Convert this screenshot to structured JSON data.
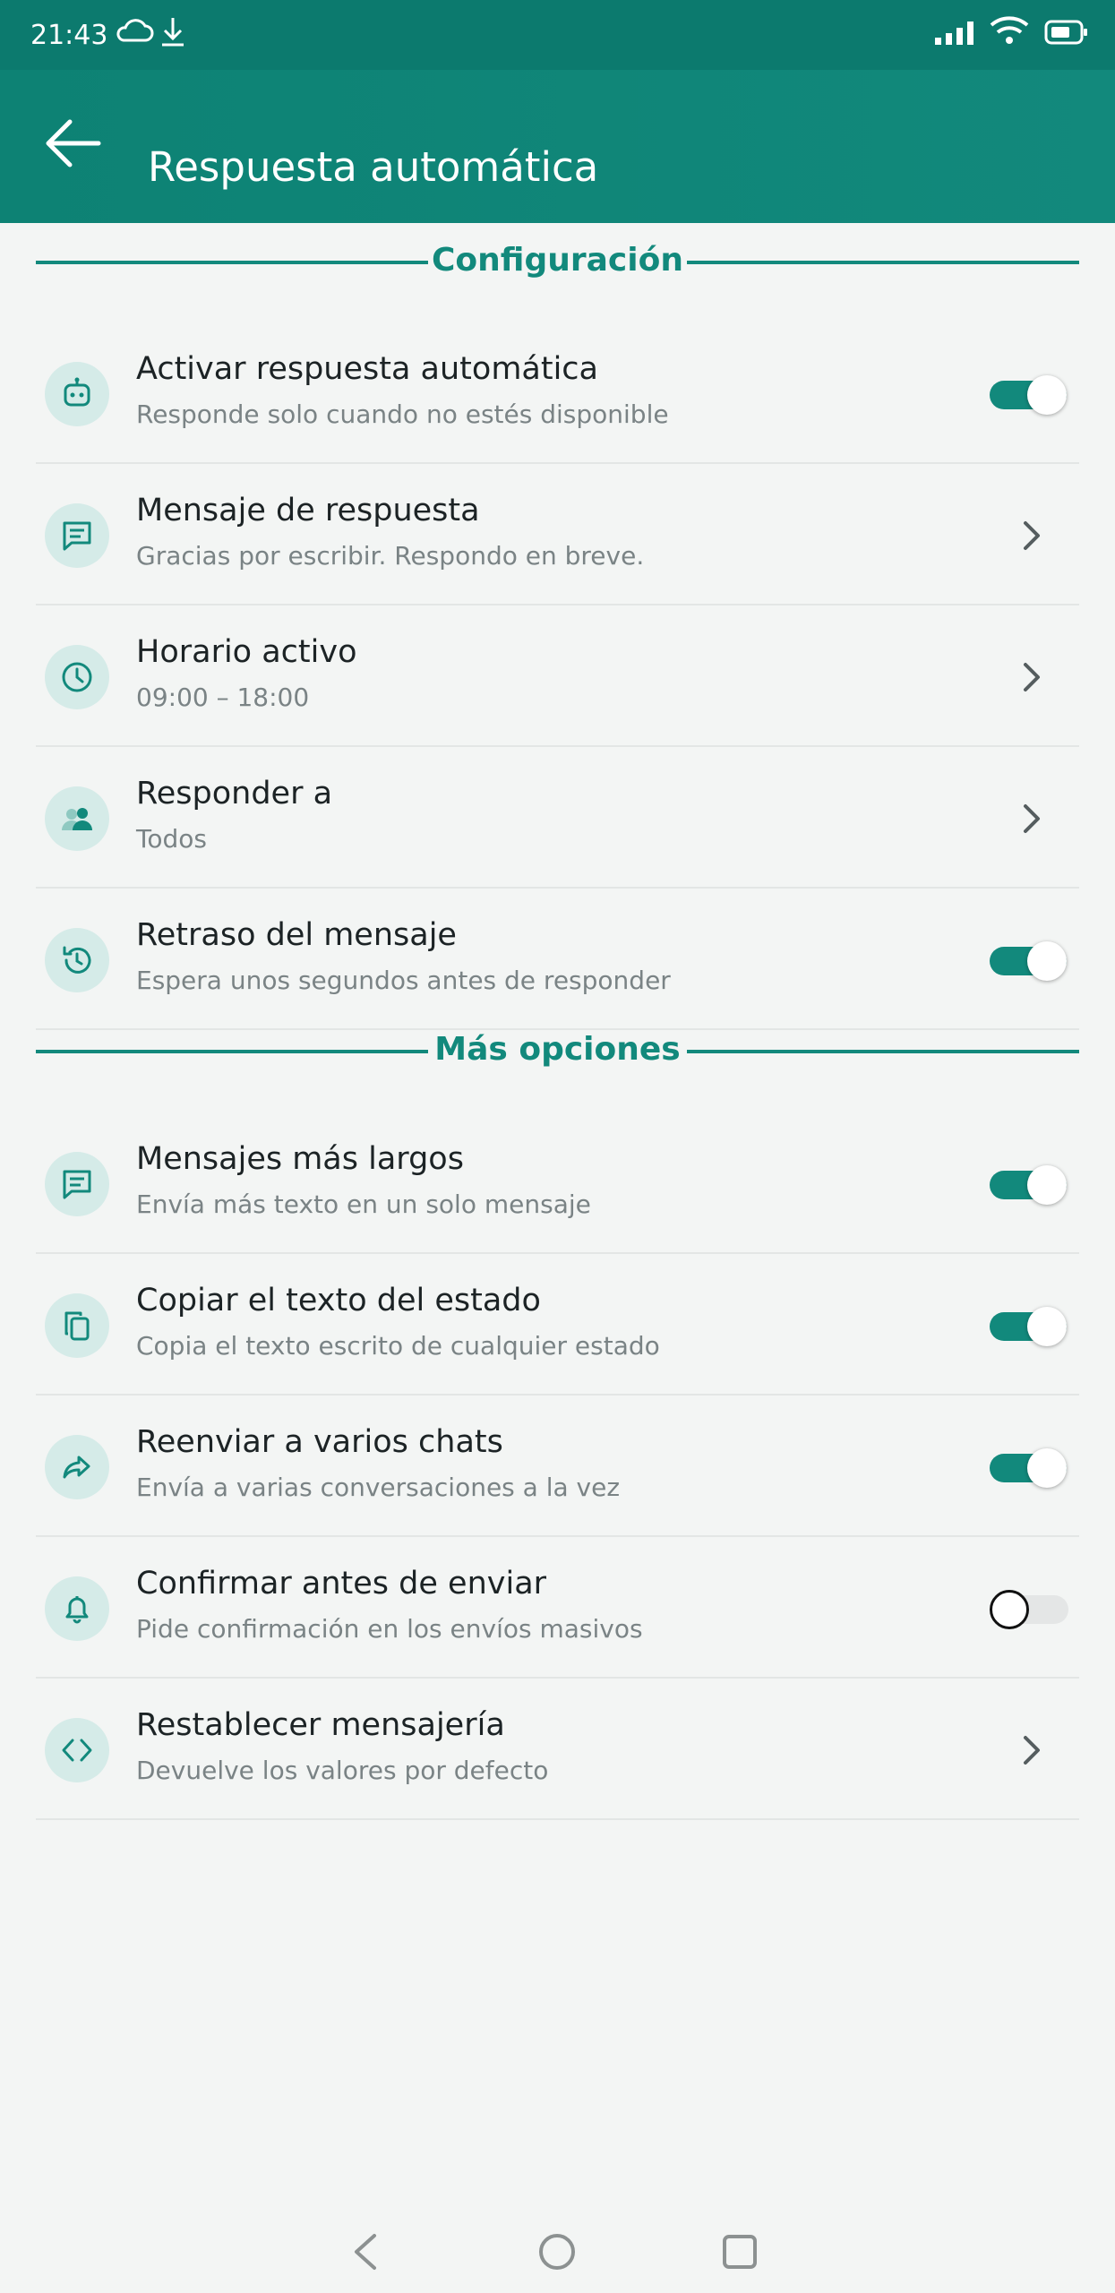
{
  "status_bar": {
    "time": "21:43",
    "icons": [
      "cloud-icon",
      "download-icon",
      "signal-icon",
      "wifi-icon",
      "battery-icon"
    ]
  },
  "app_bar": {
    "title": "Respuesta automática",
    "back_icon": "arrow-left-icon"
  },
  "colors": {
    "primary": "#12897c",
    "status_bar": "#0c7a6e",
    "icon_bg": "#d5ebe8",
    "background": "#f3f5f4"
  },
  "sections": [
    {
      "header": "Configuración",
      "items": [
        {
          "icon": "robot-icon",
          "title": "Activar respuesta automática",
          "subtitle": "Responde solo cuando no estés disponible",
          "control": "toggle",
          "on": true
        },
        {
          "icon": "message-icon",
          "title": "Mensaje de respuesta",
          "subtitle": "Gracias por escribir. Respondo en breve.",
          "control": "chevron"
        },
        {
          "icon": "clock-icon",
          "title": "Horario activo",
          "subtitle": "09:00 – 18:00",
          "control": "chevron"
        },
        {
          "icon": "people-icon",
          "title": "Responder a",
          "subtitle": "Todos",
          "control": "chevron"
        },
        {
          "icon": "history-icon",
          "title": "Retraso del mensaje",
          "subtitle": "Espera unos segundos antes de responder",
          "control": "toggle",
          "on": true
        }
      ]
    },
    {
      "header": "Más opciones",
      "items": [
        {
          "icon": "message-icon",
          "title": "Mensajes más largos",
          "subtitle": "Envía más texto en un solo mensaje",
          "control": "toggle",
          "on": true
        },
        {
          "icon": "copy-icon",
          "title": "Copiar el texto del estado",
          "subtitle": "Copia el texto escrito de cualquier estado",
          "control": "toggle",
          "on": true
        },
        {
          "icon": "forward-icon",
          "title": "Reenviar a varios chats",
          "subtitle": "Envía a varias conversaciones a la vez",
          "control": "toggle",
          "on": true
        },
        {
          "icon": "bell-icon",
          "title": "Confirmar antes de enviar",
          "subtitle": "Pide confirmación en los envíos masivos",
          "control": "toggle",
          "on": false
        },
        {
          "icon": "code-icon",
          "title": "Restablecer mensajería",
          "subtitle": "Devuelve los valores por defecto",
          "control": "chevron"
        }
      ]
    }
  ],
  "nav_bar": [
    "back-nav-icon",
    "home-nav-icon",
    "recents-nav-icon"
  ]
}
